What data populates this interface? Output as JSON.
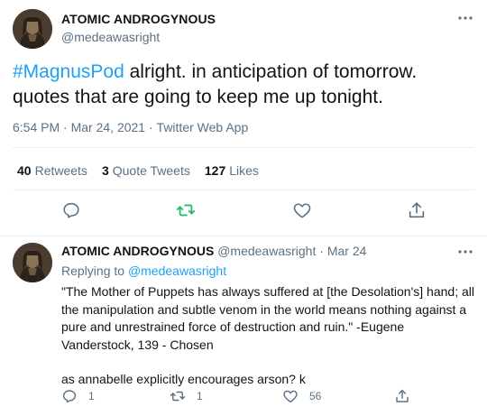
{
  "main_tweet": {
    "display_name": "ATOMIC ANDROGYNOUS",
    "handle": "@medeawasright",
    "hashtag": "#MagnusPod",
    "text": " alright. in anticipation of tomorrow. quotes that are going to keep me up tonight.",
    "time": "6:54 PM",
    "date": "Mar 24, 2021",
    "source": "Twitter Web App",
    "separator": " · ",
    "stats": {
      "retweets_count": "40",
      "retweets_label": "Retweets",
      "quotes_count": "3",
      "quotes_label": "Quote Tweets",
      "likes_count": "127",
      "likes_label": "Likes"
    }
  },
  "reply_tweet": {
    "display_name": "ATOMIC ANDROGYNOUS",
    "handle": "@medeawasright",
    "separator": " · ",
    "date": "Mar 24",
    "replying_prefix": "Replying to ",
    "replying_to": "@medeawasright",
    "quote": "\"The Mother of Puppets has always suffered at [the Desolation's] hand; all the manipulation and subtle venom in the world means nothing against a pure and unrestrained force of destruction and ruin.\" -Eugene Vanderstock, 139 - Chosen",
    "comment": "as annabelle explicitly encourages arson? k",
    "reply_count": "1",
    "retweet_count": "1",
    "like_count": "56"
  },
  "icons": [
    "more-icon",
    "reply-icon",
    "retweet-icon",
    "like-icon",
    "share-icon"
  ],
  "colors": {
    "accent": "#1da1f2",
    "retweet_active": "#17bf63",
    "muted": "#5b7083",
    "text": "#0f1419",
    "divider": "#ebeef0"
  }
}
